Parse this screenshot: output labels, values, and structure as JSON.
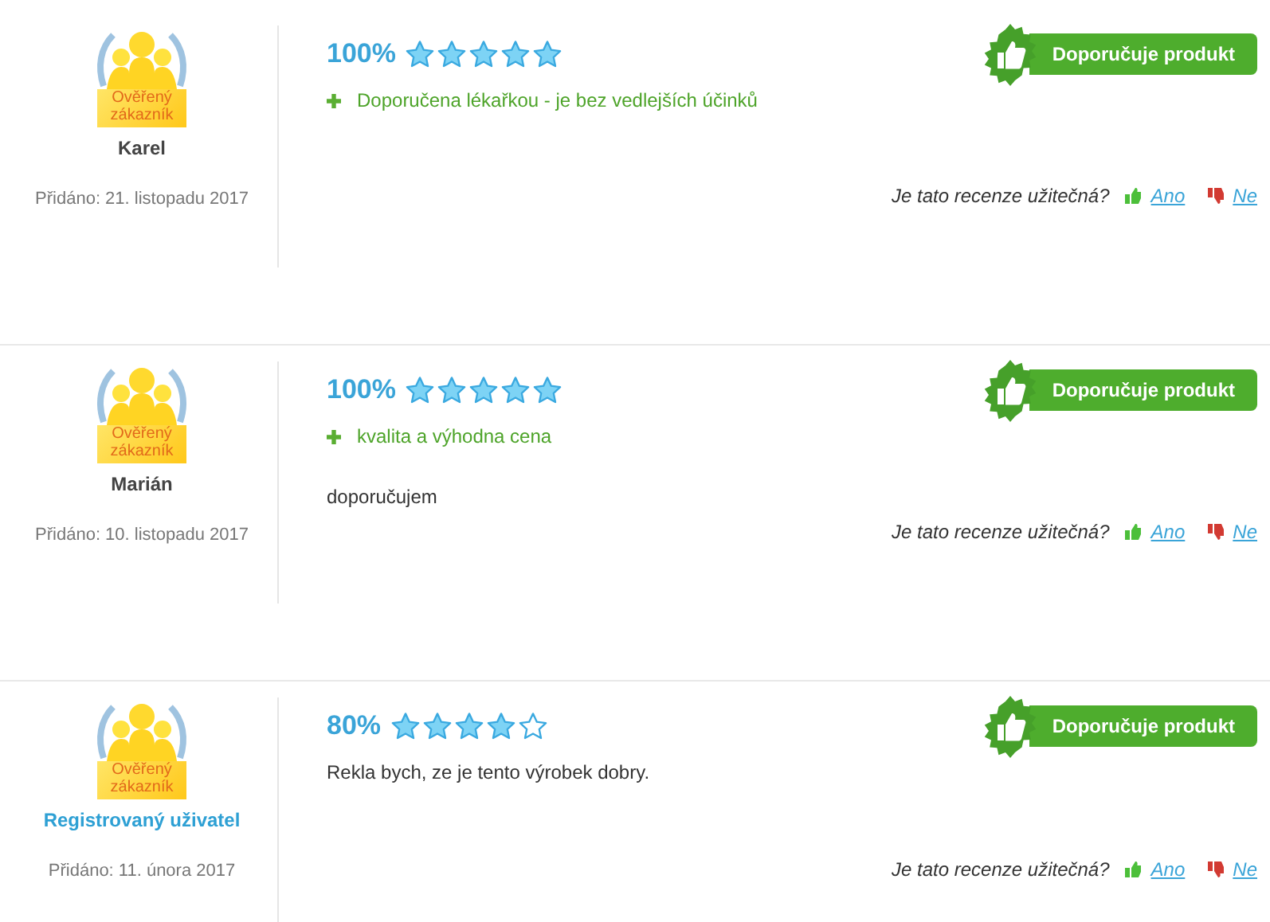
{
  "reviews": [
    {
      "badge": [
        "Ověřený",
        "zákazník"
      ],
      "author": "Karel",
      "kind": "name",
      "date": "Přidáno: 21. listopadu 2017",
      "percent": "100%",
      "stars": 5,
      "pros": [
        "Doporučena lékařkou - je bez vedlejších účinků"
      ],
      "recommend": "Doporučuje produkt",
      "question": "Je tato recenze užitečná?",
      "yes": "Ano",
      "no": "Ne"
    },
    {
      "badge": [
        "Ověřený",
        "zákazník"
      ],
      "author": "Marián",
      "kind": "name",
      "date": "Přidáno: 10. listopadu 2017",
      "percent": "100%",
      "stars": 5,
      "pros": [
        "kvalita a výhodna cena"
      ],
      "text": "doporučujem",
      "recommend": "Doporučuje produkt",
      "question": "Je tato recenze užitečná?",
      "yes": "Ano",
      "no": "Ne"
    },
    {
      "badge": [
        "Ověřený",
        "zákazník"
      ],
      "author": "Registrovaný uživatel",
      "kind": "registered",
      "date": "Přidáno: 11. února 2017",
      "percent": "80%",
      "stars": 4,
      "text": "Rekla bych, ze je tento výrobek dobry.",
      "recommend": "Doporučuje produkt",
      "question": "Je tato recenze užitečná?",
      "yes": "Ano",
      "no": "Ne"
    }
  ]
}
